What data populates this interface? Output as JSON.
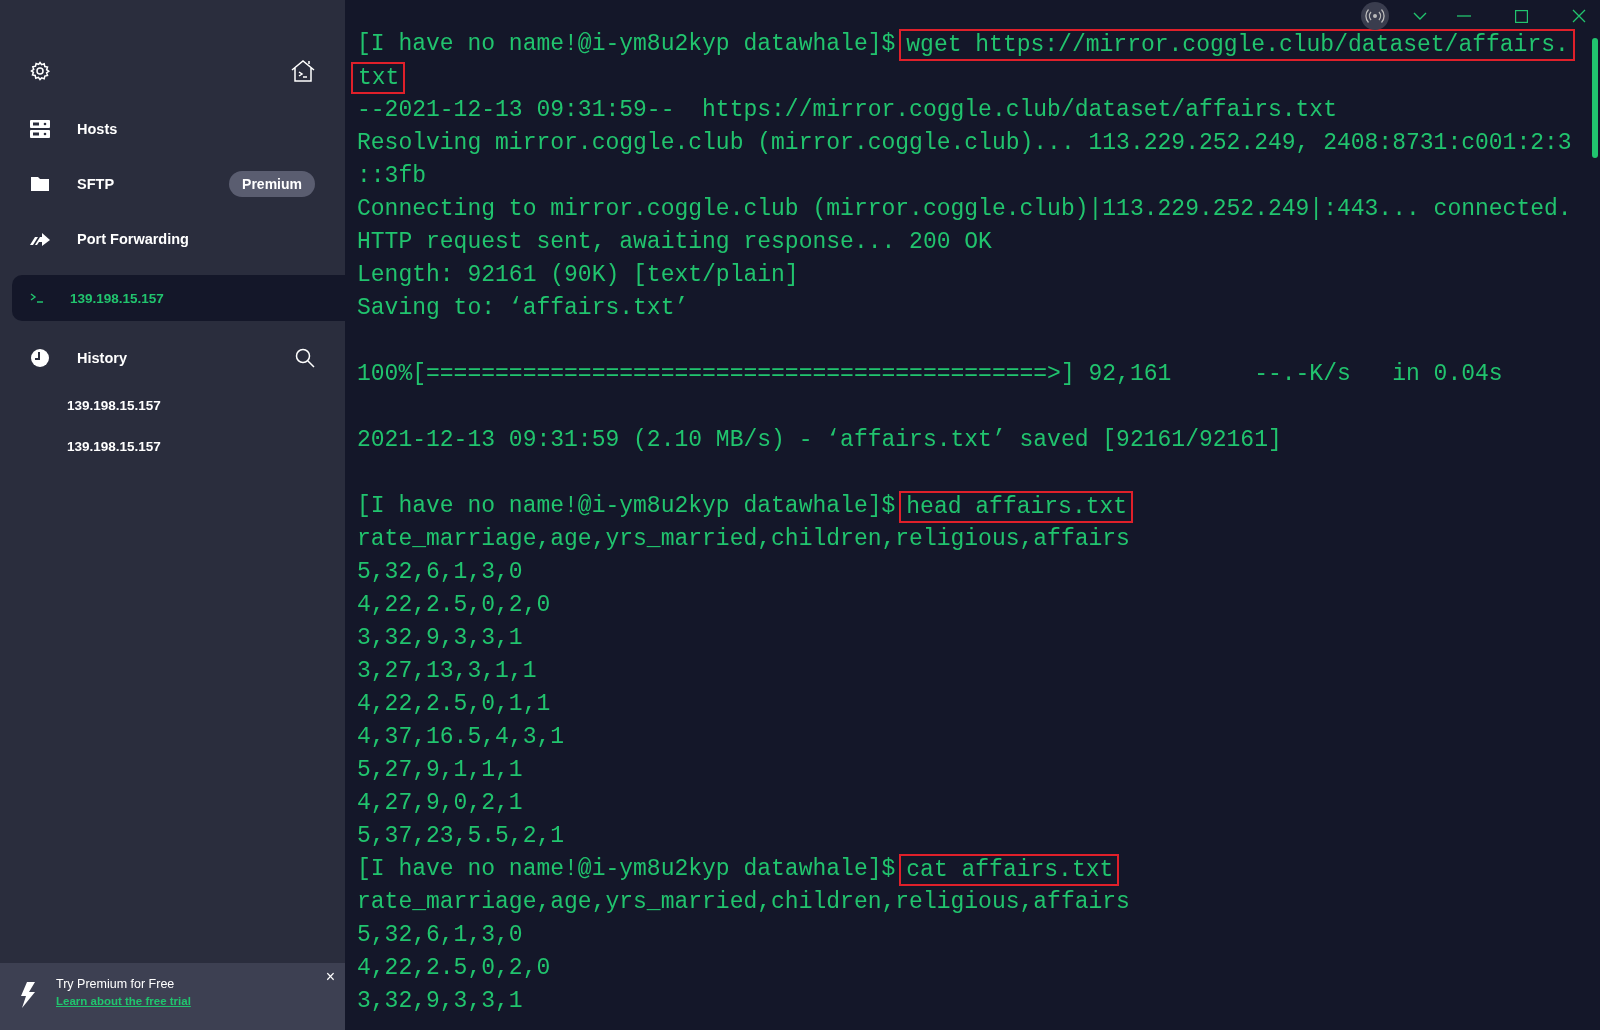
{
  "sidebar": {
    "nav": [
      {
        "kind": "hosts",
        "label": "Hosts"
      },
      {
        "kind": "sftp",
        "label": "SFTP",
        "badge": "Premium"
      },
      {
        "kind": "port",
        "label": "Port Forwarding"
      }
    ],
    "sessions": [
      {
        "label": "139.198.15.157",
        "selected": true
      }
    ],
    "history": {
      "label": "History",
      "items": [
        "139.198.15.157",
        "139.198.15.157"
      ]
    },
    "promo": {
      "title": "Try Premium for Free",
      "link": "Learn about the free trial",
      "close": "×"
    }
  },
  "terminal": {
    "lines": [
      {
        "kind": "prompt",
        "prompt": "[I have no name!@i-ym8u2kyp datawhale]$",
        "command": "wget https://mirror.coggle.club/dataset/affairs."
      },
      {
        "kind": "continuation",
        "command": "txt"
      },
      {
        "kind": "output",
        "text": "--2021-12-13 09:31:59--  https://mirror.coggle.club/dataset/affairs.txt"
      },
      {
        "kind": "output",
        "text": "Resolving mirror.coggle.club (mirror.coggle.club)... 113.229.252.249, 2408:8731:c001:2:3"
      },
      {
        "kind": "output",
        "text": "::3fb"
      },
      {
        "kind": "output",
        "text": "Connecting to mirror.coggle.club (mirror.coggle.club)|113.229.252.249|:443... connected."
      },
      {
        "kind": "output",
        "text": "HTTP request sent, awaiting response... 200 OK"
      },
      {
        "kind": "output",
        "text": "Length: 92161 (90K) [text/plain]"
      },
      {
        "kind": "output",
        "text": "Saving to: ‘affairs.txt’"
      },
      {
        "kind": "blank"
      },
      {
        "kind": "output",
        "text": "100%[=============================================>] 92,161      --.-K/s   in 0.04s"
      },
      {
        "kind": "blank"
      },
      {
        "kind": "output",
        "text": "2021-12-13 09:31:59 (2.10 MB/s) - ‘affairs.txt’ saved [92161/92161]"
      },
      {
        "kind": "blank"
      },
      {
        "kind": "prompt",
        "prompt": "[I have no name!@i-ym8u2kyp datawhale]$",
        "command": "head affairs.txt"
      },
      {
        "kind": "output",
        "text": "rate_marriage,age,yrs_married,children,religious,affairs"
      },
      {
        "kind": "output",
        "text": "5,32,6,1,3,0"
      },
      {
        "kind": "output",
        "text": "4,22,2.5,0,2,0"
      },
      {
        "kind": "output",
        "text": "3,32,9,3,3,1"
      },
      {
        "kind": "output",
        "text": "3,27,13,3,1,1"
      },
      {
        "kind": "output",
        "text": "4,22,2.5,0,1,1"
      },
      {
        "kind": "output",
        "text": "4,37,16.5,4,3,1"
      },
      {
        "kind": "output",
        "text": "5,27,9,1,1,1"
      },
      {
        "kind": "output",
        "text": "4,27,9,0,2,1"
      },
      {
        "kind": "output",
        "text": "5,37,23,5.5,2,1"
      },
      {
        "kind": "prompt",
        "prompt": "[I have no name!@i-ym8u2kyp datawhale]$",
        "command": "cat affairs.txt"
      },
      {
        "kind": "output",
        "text": "rate_marriage,age,yrs_married,children,religious,affairs"
      },
      {
        "kind": "output",
        "text": "5,32,6,1,3,0"
      },
      {
        "kind": "output",
        "text": "4,22,2.5,0,2,0"
      },
      {
        "kind": "output",
        "text": "3,32,9,3,3,1"
      }
    ]
  }
}
